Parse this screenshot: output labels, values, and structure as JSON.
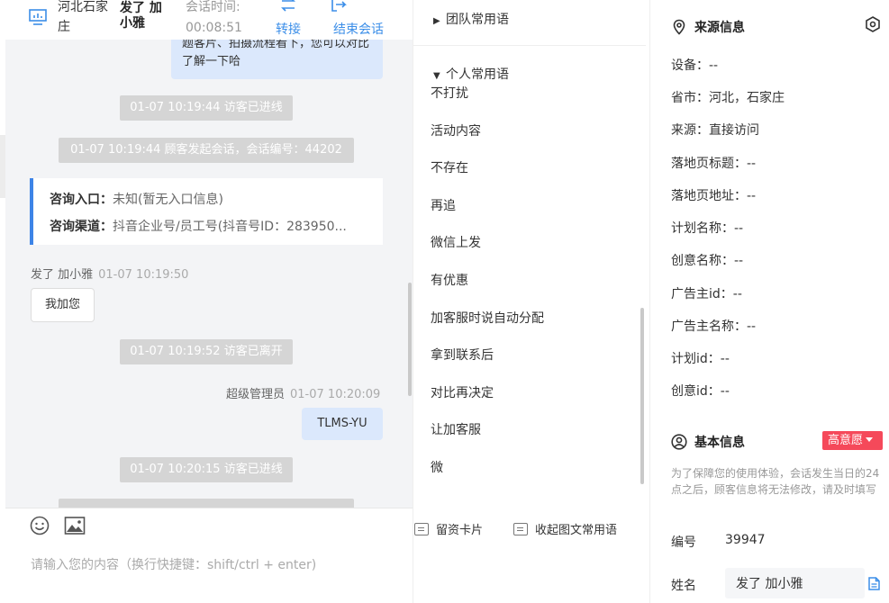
{
  "header": {
    "visitor_location": "河北石家庄",
    "visitor_name": "发了 加小雅",
    "session_time_label": "会话时间:",
    "session_time": "00:08:51",
    "transfer_label": "转接",
    "end_label": "结束会话"
  },
  "chat": {
    "top_bubble_text": "题客片、拍摄流程看下，您可以对比了解一下哈",
    "system_messages": [
      "01-07 10:19:44 访客已进线",
      "01-07 10:19:44 顾客发起会话，会话编号：44202",
      "01-07 10:19:52 访客已离开",
      "01-07 10:20:15 访客已进线"
    ],
    "card": {
      "entry_label": "咨询入口：",
      "entry_value": "未知(暂无入口信息)",
      "channel_label": "咨询渠道：",
      "channel_value": "抖音企业号/员工号(抖音号ID：283950..."
    },
    "visitor_sender": "发了 加小雅",
    "visitor_time": "01-07 10:19:50",
    "visitor_message": "我加您",
    "agent_sender": "超级管理员",
    "agent_time": "01-07 10:20:09",
    "agent_message": "TLMS-YU"
  },
  "input": {
    "placeholder": "请输入您的内容（换行快捷键：shift/ctrl + enter)"
  },
  "phrases": {
    "team_group": "团队常用语",
    "personal_group": "个人常用语",
    "items": [
      "不打扰",
      "活动内容",
      "不存在",
      "再追",
      "微信上发",
      "有优惠",
      "加客服时说自动分配",
      "拿到联系后",
      "对比再决定",
      "让加客服",
      "微"
    ],
    "tool_card": "留资卡片",
    "tool_collapse": "收起图文常用语"
  },
  "source_info": {
    "title": "来源信息",
    "rows": [
      "设备：--",
      "省市：河北，石家庄",
      "来源：直接访问",
      "落地页标题：--",
      "落地页地址：--",
      "计划名称：--",
      "创意名称：--",
      "广告主id：--",
      "广告主名称：--",
      "计划id：--",
      "创意id：--"
    ]
  },
  "basic_info": {
    "title": "基本信息",
    "intent_badge": "高意愿",
    "notice": "为了保障您的使用体验，会话发生当日的24点之后，顾客信息将无法修改，请及时填写",
    "id_label": "编号",
    "id_value": "39947",
    "name_label": "姓名",
    "name_value": "发了 加小雅"
  },
  "colors": {
    "accent": "#3b8ee8",
    "badge": "#f5495a",
    "agent_bubble": "#dbe8fc",
    "system_message": "#d5d5d5"
  }
}
